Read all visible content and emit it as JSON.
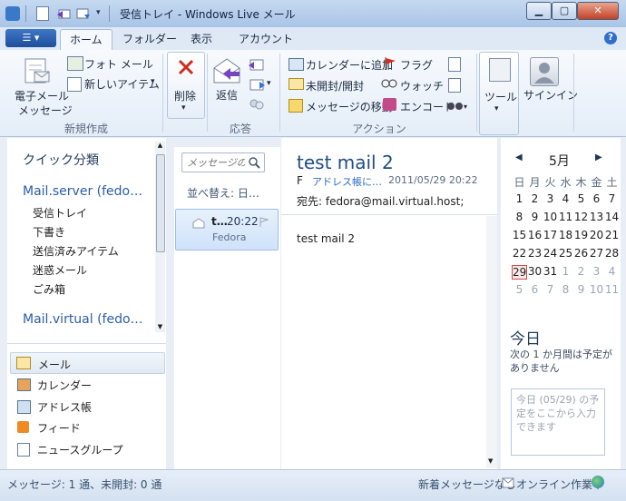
{
  "window": {
    "title": "受信トレイ - Windows Live メール"
  },
  "ribbon": {
    "tabs": [
      "ホーム",
      "フォルダー",
      "表示",
      "アカウント"
    ],
    "new_group": {
      "label": "新規作成",
      "email_line1": "電子メール",
      "email_line2": "メッセージ",
      "photo_mail": "フォト メール",
      "new_item": "新しいアイテム"
    },
    "delete_group": {
      "delete": "削除"
    },
    "reply_group": {
      "label": "応答",
      "reply": "返信"
    },
    "action_group": {
      "label": "アクション",
      "add_calendar": "カレンダーに追加",
      "unread_read": "未開封/開封",
      "move_message": "メッセージの移動",
      "flag": "フラグ",
      "watch": "ウォッチ",
      "encode": "エンコード"
    },
    "tools": "ツール",
    "signin": "サインイン"
  },
  "nav": {
    "quick_views": "クイック分類",
    "account1": "Mail.server (fedo…",
    "folders": [
      "受信トレイ",
      "下書き",
      "送信済みアイテム",
      "迷惑メール",
      "ごみ箱"
    ],
    "account2": "Mail.virtual (fedo…",
    "bottom": [
      "メール",
      "カレンダー",
      "アドレス帳",
      "フィード",
      "ニュースグループ"
    ]
  },
  "list": {
    "search_placeholder": "メッセージの",
    "sort": "並べ替え: 日…",
    "message": {
      "sender_short": "t…",
      "time": "20:22",
      "from": "Fedora"
    }
  },
  "reading": {
    "subject": "test mail 2",
    "from_initial": "F",
    "add_contact": "アドレス帳に…",
    "date": "2011/05/29 20:22",
    "to": "宛先: fedora@mail.virtual.host;",
    "body": "test mail 2"
  },
  "calendar": {
    "month": "5月",
    "weekdays": [
      "日",
      "月",
      "火",
      "水",
      "木",
      "金",
      "土"
    ],
    "weeks": [
      [
        "1",
        "2",
        "3",
        "4",
        "5",
        "6",
        "7"
      ],
      [
        "8",
        "9",
        "10",
        "11",
        "12",
        "13",
        "14"
      ],
      [
        "15",
        "16",
        "17",
        "18",
        "19",
        "20",
        "21"
      ],
      [
        "22",
        "23",
        "24",
        "25",
        "26",
        "27",
        "28"
      ],
      [
        "29",
        "30",
        "31",
        "1",
        "2",
        "3",
        "4"
      ],
      [
        "5",
        "6",
        "7",
        "8",
        "9",
        "10",
        "11"
      ]
    ],
    "today_heading": "今日",
    "today_text": "次の 1 か月間は予定がありません",
    "today_input_placeholder": "今日 (05/29) の予定をここから入力できます"
  },
  "status": {
    "left": "メッセージ: 1 通、未開封: 0 通",
    "no_new": "新着メッセージなし",
    "online": "オンライン作業中"
  }
}
